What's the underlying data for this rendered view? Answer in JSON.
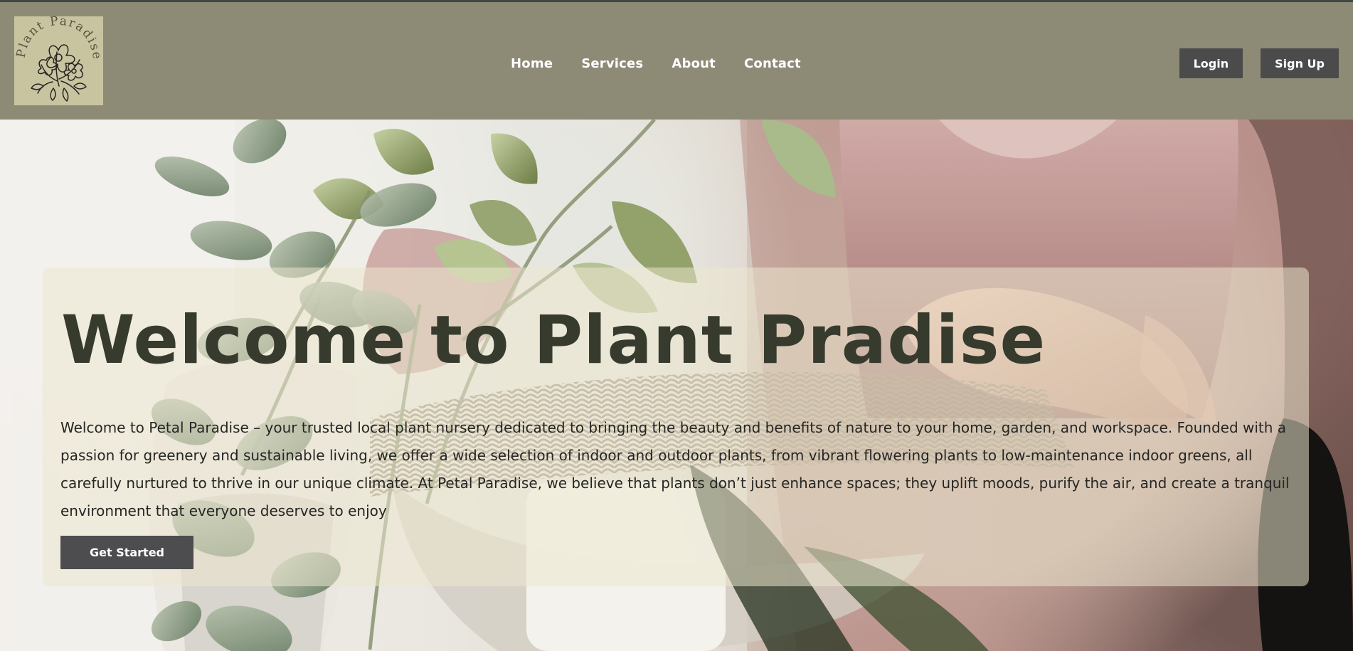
{
  "brand": {
    "logo_text": "Plant Paradise",
    "logo_icon": "flower-icon"
  },
  "navigation": {
    "items": [
      {
        "label": "Home"
      },
      {
        "label": "Services"
      },
      {
        "label": "About"
      },
      {
        "label": "Contact"
      }
    ]
  },
  "auth": {
    "login_label": "Login",
    "signup_label": "Sign Up"
  },
  "hero": {
    "title": "Welcome to Plant Pradise",
    "description": "Welcome to Petal Paradise – your trusted local plant nursery dedicated to bringing the beauty and benefits of nature to your home, garden, and workspace. Founded with a passion for greenery and sustainable living, we offer a wide selection of indoor and outdoor plants, from vibrant flowering plants to low-maintenance indoor greens, all carefully nurtured to thrive in our unique climate. At Petal Paradise, we believe that plants don’t just enhance spaces; they uplift moods, purify the air, and create a tranquil environment that everyone deserves to enjoy",
    "cta_label": "Get Started"
  },
  "colors": {
    "header": "#8d8a76",
    "logo_background": "#c9c4a0",
    "button": "#4b4b4b",
    "title": "#373b2d",
    "panel_overlay": "#ece7cf"
  }
}
